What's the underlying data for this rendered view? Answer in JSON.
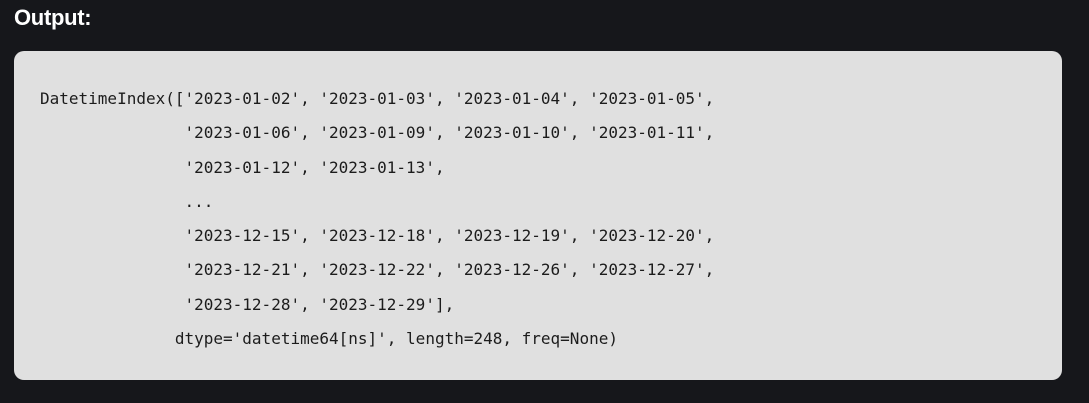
{
  "heading": "Output:",
  "output": {
    "lines": [
      "DatetimeIndex(['2023-01-02', '2023-01-03', '2023-01-04', '2023-01-05',",
      "               '2023-01-06', '2023-01-09', '2023-01-10', '2023-01-11',",
      "               '2023-01-12', '2023-01-13',",
      "               ...",
      "               '2023-12-15', '2023-12-18', '2023-12-19', '2023-12-20',",
      "               '2023-12-21', '2023-12-22', '2023-12-26', '2023-12-27',",
      "               '2023-12-28', '2023-12-29'],",
      "              dtype='datetime64[ns]', length=248, freq=None)"
    ]
  }
}
